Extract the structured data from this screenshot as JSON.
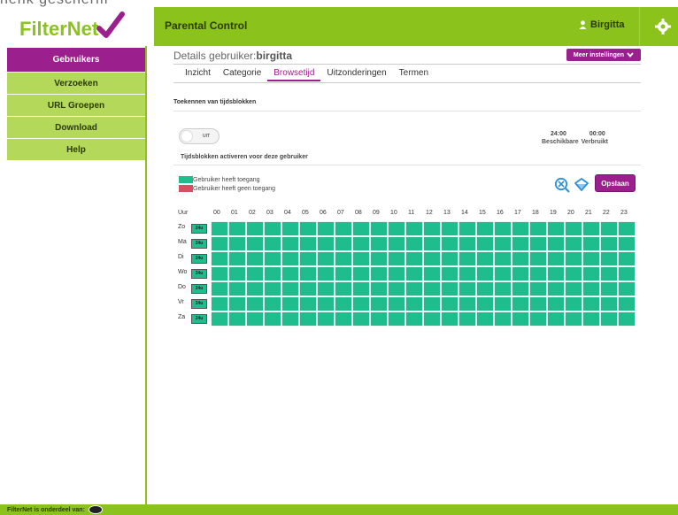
{
  "app": {
    "logo_text_filter": "Filter",
    "logo_text_net": "Net",
    "header_title": "Parental Control",
    "user_name": "Birgitta",
    "colors": {
      "accent_green": "#8bc21b",
      "accent_purple": "#9b1f8c",
      "access_green": "#1fbd8d",
      "no_access_red": "#d35160"
    }
  },
  "topstrip": {
    "text": "henk gescherm"
  },
  "sidebar": {
    "items": [
      {
        "label": "Gebruikers",
        "active": true
      },
      {
        "label": "Verzoeken",
        "active": false
      },
      {
        "label": "URL Groepen",
        "active": false
      },
      {
        "label": "Download",
        "active": false
      },
      {
        "label": "Help",
        "active": false
      }
    ]
  },
  "main": {
    "details_prefix": "Details gebruiker:",
    "details_user": "birgitta",
    "meer_label": "Meer instellingen",
    "tabs": [
      {
        "label": "Inzicht",
        "active": false
      },
      {
        "label": "Categorie",
        "active": false
      },
      {
        "label": "Browsetijd",
        "active": true
      },
      {
        "label": "Uitzonderingen",
        "active": false
      },
      {
        "label": "Termen",
        "active": false
      }
    ],
    "section_title": "Toekennen van tijdsblokken",
    "toggle_label": "UIT",
    "beschikbare_value": "24:00",
    "verbruikt_value": "00:00",
    "beschikbare_label": "Beschikbare",
    "verbruikt_label": "Verbruikt",
    "activeer_label": "Tijdsblokken activeren voor deze gebruiker",
    "legend": [
      {
        "label": "Gebruiker heeft toegang",
        "color": "#1fbd8d"
      },
      {
        "label": "Gebruiker heeft geen toegang",
        "color": "#d35160"
      }
    ],
    "save_label": "Opslaan",
    "icons": {
      "clear": "clear-schedule-icon",
      "fill": "fill-schedule-icon",
      "user": "user-icon",
      "gear": "gear-icon"
    }
  },
  "schedule": {
    "hour_label": "Uur",
    "hours": [
      "00",
      "01",
      "02",
      "03",
      "04",
      "05",
      "06",
      "07",
      "08",
      "09",
      "10",
      "11",
      "12",
      "13",
      "14",
      "15",
      "16",
      "17",
      "18",
      "19",
      "20",
      "21",
      "22",
      "23"
    ],
    "days": [
      {
        "label": "Zo",
        "chip": "24u"
      },
      {
        "label": "Ma",
        "chip": "24u"
      },
      {
        "label": "Di",
        "chip": "24u"
      },
      {
        "label": "Wo",
        "chip": "24u"
      },
      {
        "label": "Do",
        "chip": "24u"
      },
      {
        "label": "Vr",
        "chip": "24u"
      },
      {
        "label": "Za",
        "chip": "24u"
      }
    ]
  },
  "footer": {
    "text": "FilterNet is onderdeel van:"
  }
}
